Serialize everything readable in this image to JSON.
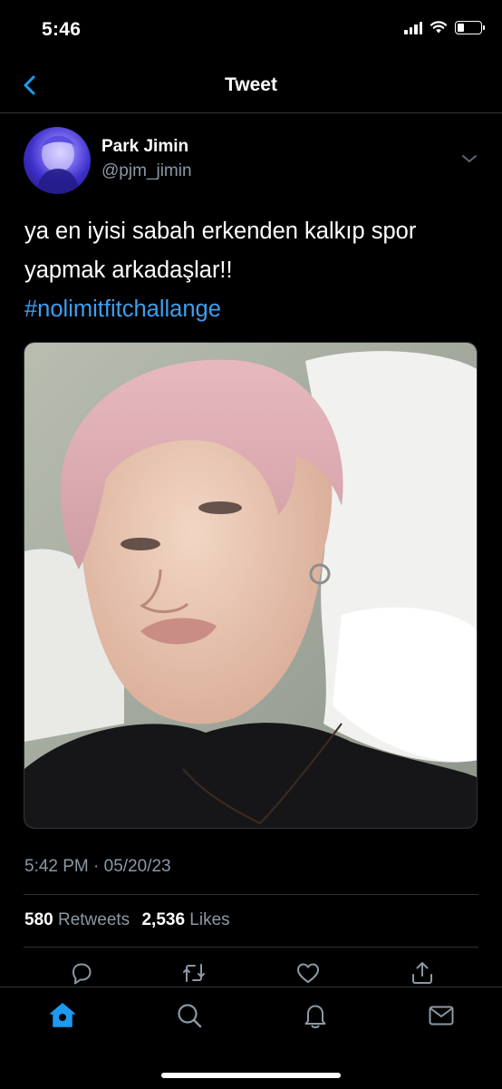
{
  "status_bar": {
    "time": "5:46",
    "battery_level": 0.3
  },
  "nav": {
    "title": "Tweet"
  },
  "tweet": {
    "author": {
      "display_name": "Park Jimin",
      "handle": "@pjm_jimin"
    },
    "text_line_1": "ya en iyisi sabah erkenden kalkıp spor",
    "text_line_2": "yapmak arkadaşlar!!",
    "hashtag": "#nolimitfitchallange",
    "timestamp": "5:42 PM · 05/20/23",
    "retweets": {
      "count": "580",
      "label": "Retweets"
    },
    "likes": {
      "count": "2,536",
      "label": "Likes"
    }
  },
  "actions": [
    "reply-icon",
    "retweet-icon",
    "like-icon",
    "share-icon"
  ],
  "tabs": [
    "home-icon",
    "search-icon",
    "notifications-icon",
    "messages-icon"
  ],
  "colors": {
    "accent": "#1d9bf0",
    "link": "#3d9ff0",
    "secondary_text": "#8b98a5",
    "divider": "#2f3336"
  }
}
